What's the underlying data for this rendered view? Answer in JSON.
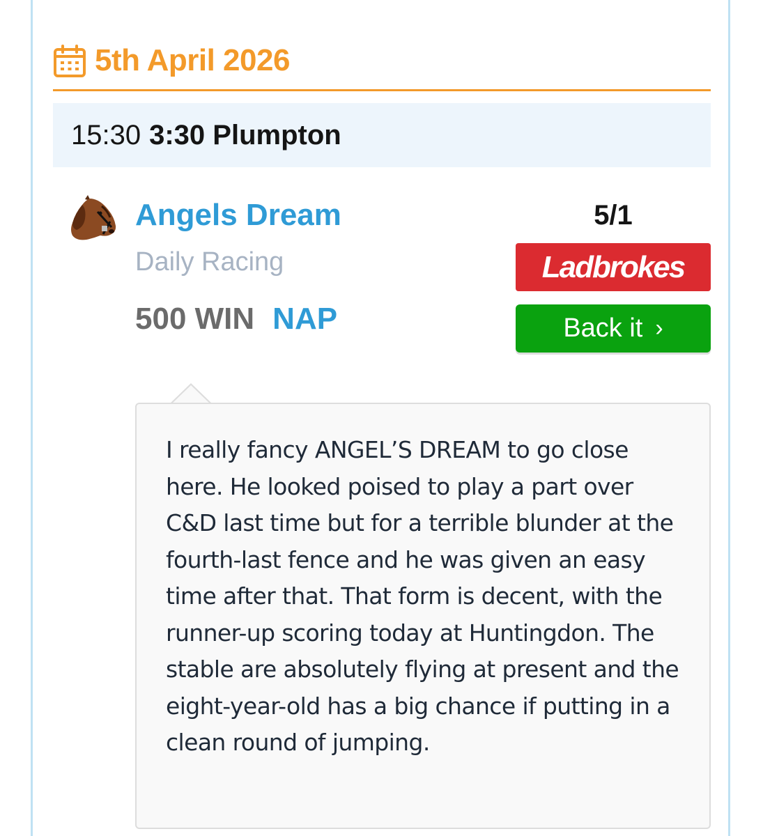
{
  "date": {
    "icon": "calendar-icon",
    "label": "5th April 2026",
    "color": "#f39a2a"
  },
  "race": {
    "time": "15:30",
    "title": "3:30 Plumpton"
  },
  "selection": {
    "avatar_icon": "horse-head-icon",
    "horse": "Angels Dream",
    "tipster": "Daily Racing",
    "stake": "500 WIN",
    "tag": "NAP",
    "odds": "5/1",
    "bookmaker": "Ladbrokes",
    "back_label": "Back it",
    "back_icon": "chevron-right-icon"
  },
  "comment": {
    "text": "I really fancy ANGEL’S DREAM to go close here. He looked poised to play a part over C&D last time but for a terrible blunder at the fourth-last fence and he was given an easy time after that. That form is decent, with the runner-up scoring today at Huntingdon. The stable are absolutely flying at present and the eight-year-old has a big chance if putting in a clean round of jumping."
  },
  "colors": {
    "accent_blue": "#2f9bd6",
    "bookmaker_red": "#db2b30",
    "back_green": "#0aa20f"
  }
}
